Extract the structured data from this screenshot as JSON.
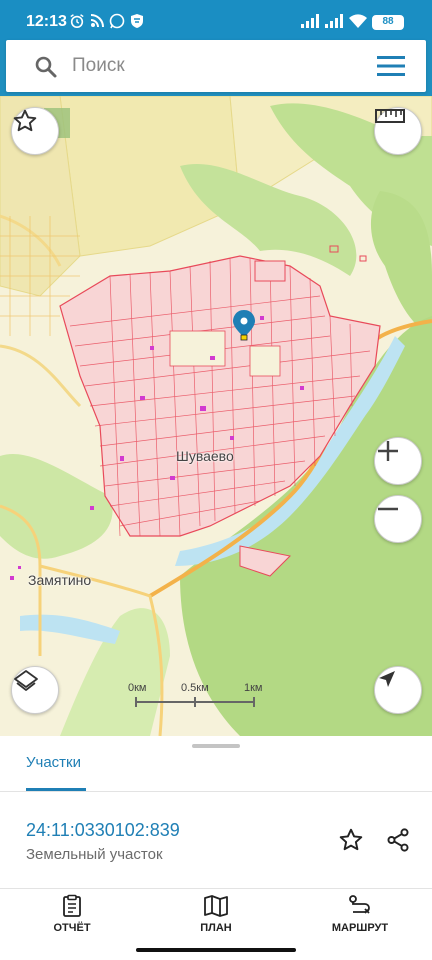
{
  "status": {
    "time": "12:13",
    "battery": "88"
  },
  "search": {
    "placeholder": "Поиск"
  },
  "map": {
    "place_labels": [
      "Шуваево",
      "Замятино"
    ],
    "scale_ticks": [
      "0км",
      "0.5км",
      "1км"
    ]
  },
  "panel": {
    "tab_label": "Участки",
    "cadastral_number": "24:11:0330102:839",
    "object_type": "Земельный участок"
  },
  "bottom_nav": [
    {
      "label": "ОТЧЁТ",
      "icon": "report-icon"
    },
    {
      "label": "ПЛАН",
      "icon": "map-plan-icon"
    },
    {
      "label": "МАРШРУТ",
      "icon": "route-icon"
    }
  ],
  "colors": {
    "accent": "#1f7fb5",
    "status_bar": "#1a8ec3",
    "parcel": "#e84a5a",
    "forest": "#b8dc8a",
    "water": "#bde3f2",
    "road": "#f3b24a"
  }
}
